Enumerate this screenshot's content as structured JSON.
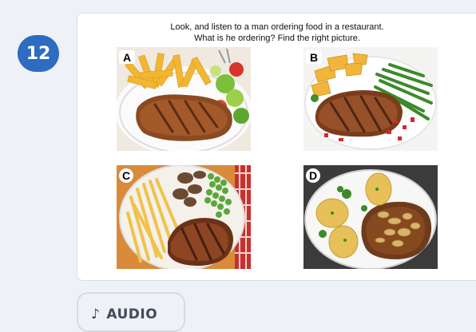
{
  "question": {
    "number": "12",
    "instruction_line1": "Look, and listen to a man ordering food in a restaurant.",
    "instruction_line2": "What is he ordering? Find the right picture."
  },
  "options": [
    {
      "letter": "A"
    },
    {
      "letter": "B"
    },
    {
      "letter": "C"
    },
    {
      "letter": "D"
    }
  ],
  "audio": {
    "icon": "♪",
    "label": "AUDIO"
  },
  "colors": {
    "badge": "#2d6cc0",
    "page_bg": "#eef1f5"
  }
}
